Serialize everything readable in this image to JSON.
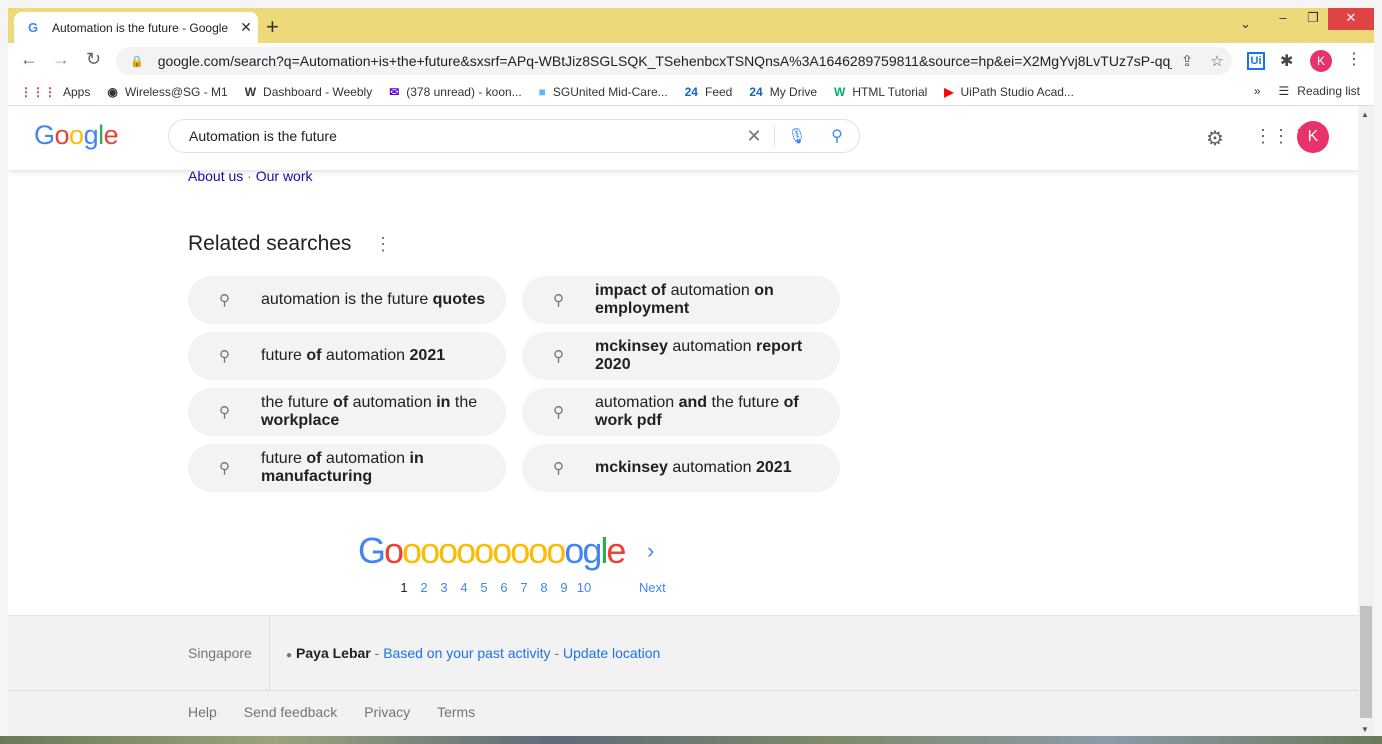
{
  "browser": {
    "tab_title": "Automation is the future - Google",
    "tab_favicon": "G",
    "url": "google.com/search?q=Automation+is+the+future&sxsrf=APq-WBtJiz8SGLSQK_TSehenbcxTSNQnsA%3A1646289759811&source=hp&ei=X2MgYvj8LvTUz7sP-qq_...",
    "profile_initial": "K",
    "ext_label": "Ui",
    "bookmarks": [
      {
        "icon": "apps-icon",
        "glyph": "⋮⋮⋮",
        "label": "Apps",
        "color": "#d93025"
      },
      {
        "icon": "globe-icon",
        "glyph": "◉",
        "label": "Wireless@SG - M1",
        "color": "#333333"
      },
      {
        "icon": "weebly-icon",
        "glyph": "W",
        "label": "Dashboard - Weebly",
        "color": "#333333"
      },
      {
        "icon": "mail-icon",
        "glyph": "✉",
        "label": "(378 unread) - koon...",
        "color": "#6001d2"
      },
      {
        "icon": "page-icon",
        "glyph": "■",
        "label": "SGUnited Mid-Care...",
        "color": "#64b5f6"
      },
      {
        "icon": "feed-icon",
        "glyph": "24",
        "label": "Feed",
        "color": "#1565c0"
      },
      {
        "icon": "drive-icon",
        "glyph": "24",
        "label": "My Drive",
        "color": "#1565c0"
      },
      {
        "icon": "w3-icon",
        "glyph": "W",
        "label": "HTML Tutorial",
        "color": "#04aa6d"
      },
      {
        "icon": "youtube-icon",
        "glyph": "▶",
        "label": "UiPath Studio Acad...",
        "color": "#ff0000"
      }
    ],
    "more_bookmarks": "»",
    "reading_list": "Reading list"
  },
  "search": {
    "query": "Automation is the future",
    "avatar_initial": "K"
  },
  "about_links": {
    "about": "About us",
    "sep": "·",
    "work": "Our work"
  },
  "related": {
    "title": "Related searches",
    "chips": [
      [
        {
          "t": "automation is the future ",
          "b": false
        },
        {
          "t": "quotes",
          "b": true
        }
      ],
      [
        {
          "t": "impact of",
          "b": true
        },
        {
          "t": " automation ",
          "b": false
        },
        {
          "t": "on employment",
          "b": true
        }
      ],
      [
        {
          "t": "future ",
          "b": false
        },
        {
          "t": "of",
          "b": true
        },
        {
          "t": " automation ",
          "b": false
        },
        {
          "t": "2021",
          "b": true
        }
      ],
      [
        {
          "t": "mckinsey",
          "b": true
        },
        {
          "t": " automation ",
          "b": false
        },
        {
          "t": "report 2020",
          "b": true
        }
      ],
      [
        {
          "t": "the future ",
          "b": false
        },
        {
          "t": "of",
          "b": true
        },
        {
          "t": " automation ",
          "b": false
        },
        {
          "t": "in",
          "b": true
        },
        {
          "t": " the ",
          "b": false
        },
        {
          "t": "workplace",
          "b": true
        }
      ],
      [
        {
          "t": "automation ",
          "b": false
        },
        {
          "t": "and",
          "b": true
        },
        {
          "t": " the future ",
          "b": false
        },
        {
          "t": "of work pdf",
          "b": true
        }
      ],
      [
        {
          "t": "future ",
          "b": false
        },
        {
          "t": "of",
          "b": true
        },
        {
          "t": " automation ",
          "b": false
        },
        {
          "t": "in manufacturing",
          "b": true
        }
      ],
      [
        {
          "t": "mckinsey",
          "b": true
        },
        {
          "t": " automation ",
          "b": false
        },
        {
          "t": "2021",
          "b": true
        }
      ]
    ]
  },
  "pagination": {
    "logo_letters": [
      "G",
      "o",
      "o",
      "o",
      "o",
      "o",
      "o",
      "o",
      "o",
      "o",
      "o",
      "o",
      "g",
      "l",
      "e"
    ],
    "logo_colors": [
      "#4285f4",
      "#ea4335",
      "#fbbc05",
      "#fbbc05",
      "#fbbc05",
      "#fbbc05",
      "#fbbc05",
      "#fbbc05",
      "#fbbc05",
      "#fbbc05",
      "#fbbc05",
      "#4285f4",
      "#4285f4",
      "#34a853",
      "#ea4335"
    ],
    "pages": [
      "1",
      "2",
      "3",
      "4",
      "5",
      "6",
      "7",
      "8",
      "9",
      "10"
    ],
    "current": "1",
    "next": "Next"
  },
  "footer": {
    "country": "Singapore",
    "place": "Paya Lebar",
    "dash1": " - ",
    "activity": "Based on your past activity",
    "dash2": " - ",
    "update": "Update location",
    "links": [
      "Help",
      "Send feedback",
      "Privacy",
      "Terms"
    ]
  },
  "colors": {
    "accent": "#1a73e8",
    "brand_blue": "#4285f4",
    "avatar": "#e8336a"
  }
}
